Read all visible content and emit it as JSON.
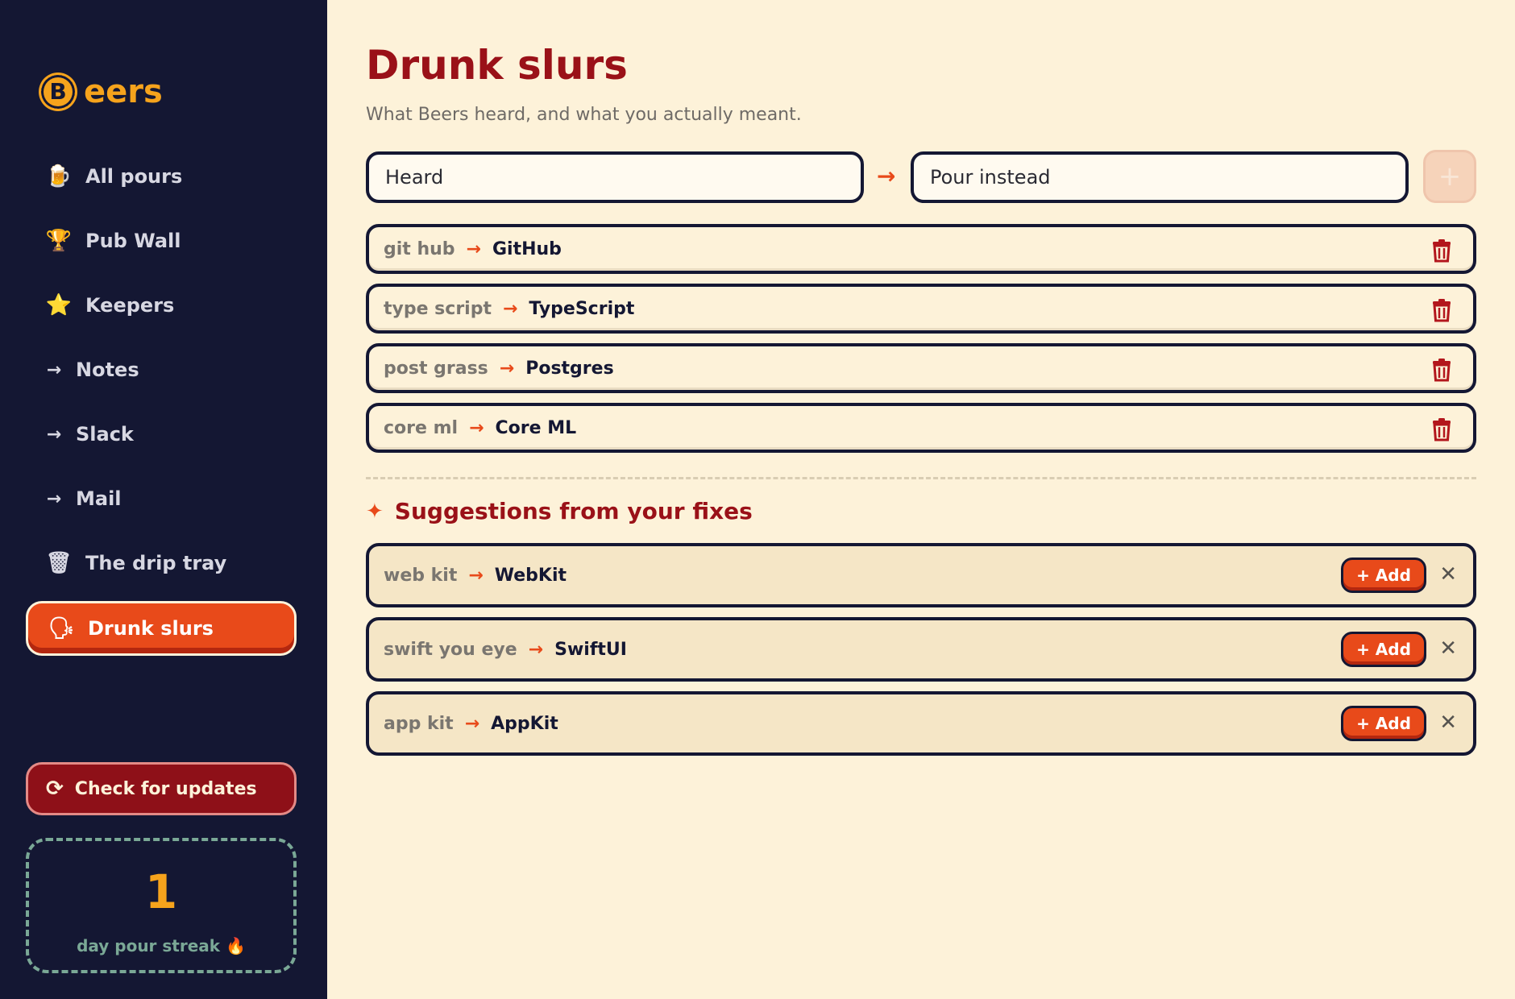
{
  "app": {
    "logo_letter": "B",
    "logo_text": "eers"
  },
  "sidebar": {
    "items": [
      {
        "label": "All pours",
        "icon": "beer-mug-icon",
        "glyph": "🍺",
        "active": false
      },
      {
        "label": "Pub Wall",
        "icon": "trophy-icon",
        "glyph": "🏆",
        "active": false
      },
      {
        "label": "Keepers",
        "icon": "star-icon",
        "glyph": "⭐",
        "active": false
      },
      {
        "label": "Notes",
        "icon": "arrow-right-icon",
        "glyph": "→",
        "active": false
      },
      {
        "label": "Slack",
        "icon": "arrow-right-icon",
        "glyph": "→",
        "active": false
      },
      {
        "label": "Mail",
        "icon": "arrow-right-icon",
        "glyph": "→",
        "active": false
      },
      {
        "label": "The drip tray",
        "icon": "trash-can-icon",
        "glyph": "🗑",
        "active": false
      },
      {
        "label": "Drunk slurs",
        "icon": "speaking-head-icon",
        "glyph": "🗣",
        "active": true
      }
    ],
    "update_label": "Check for updates",
    "update_icon": "refresh-icon",
    "streak_value": "1",
    "streak_label": "day pour streak 🔥"
  },
  "main": {
    "title": "Drunk slurs",
    "subtitle": "What Beers heard, and what you actually meant.",
    "heard_placeholder": "Heard",
    "pour_placeholder": "Pour instead",
    "add_glyph": "+",
    "arrow_glyph": "→",
    "rules": [
      {
        "heard": "git hub",
        "pour": "GitHub"
      },
      {
        "heard": "type script",
        "pour": "TypeScript"
      },
      {
        "heard": "post grass",
        "pour": "Postgres"
      },
      {
        "heard": "core ml",
        "pour": "Core ML"
      }
    ],
    "suggestions_title": "Suggestions from your fixes",
    "suggestions": [
      {
        "heard": "web kit",
        "pour": "WebKit"
      },
      {
        "heard": "swift you eye",
        "pour": "SwiftUI"
      },
      {
        "heard": "app kit",
        "pour": "AppKit"
      }
    ],
    "suggestion_add_label": "+ Add",
    "suggestion_dismiss_glyph": "✕"
  },
  "colors": {
    "sidebar_bg": "#141733",
    "page_bg": "#fdf2d9",
    "accent": "#e84a1a",
    "title_red": "#9a1118",
    "brand_amber": "#f6a31c",
    "streak_green": "#7aa896"
  }
}
